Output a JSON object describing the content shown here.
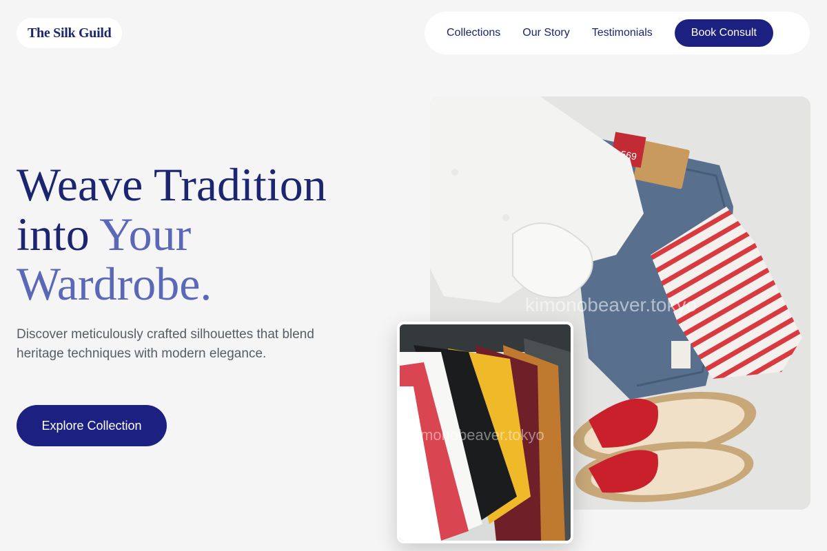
{
  "brand": {
    "name": "The Silk Guild"
  },
  "nav": {
    "links": [
      "Collections",
      "Our Story",
      "Testimonials"
    ],
    "cta": "Book Consult"
  },
  "hero": {
    "title_line1": "Weave Tradition",
    "title_line2_plain": "into ",
    "title_line2_accent": "Your",
    "title_line3_accent": "Wardrobe.",
    "subtitle": "Discover meticulously crafted silhouettes that blend heritage techniques with modern elegance.",
    "cta": "Explore Collection"
  },
  "images": {
    "main_watermark": "kimonobeaver.tokyo",
    "small_watermark": "monobeaver.tokyo",
    "jeans_tag": "569"
  },
  "colors": {
    "primary": "#1c2080",
    "heading": "#1c2570",
    "accent": "#5b68b8",
    "background": "#f5f5f5"
  }
}
